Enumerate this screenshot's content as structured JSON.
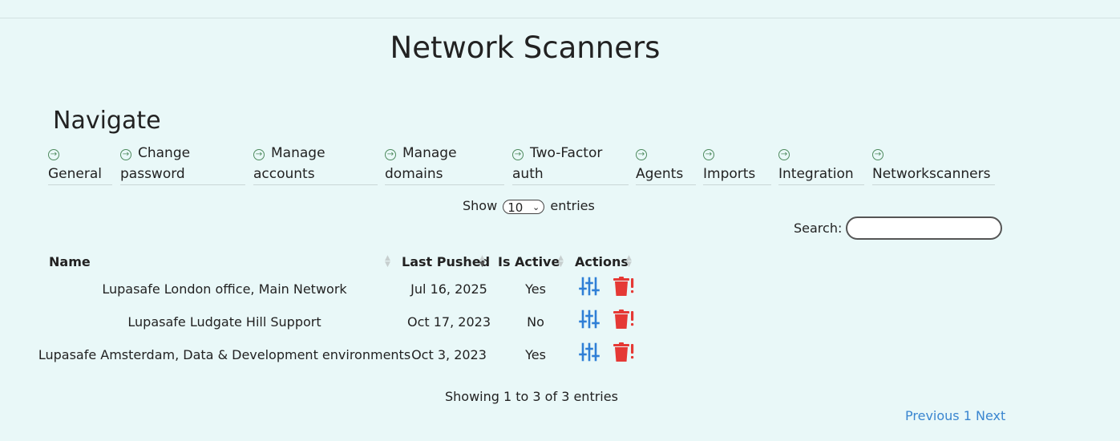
{
  "page": {
    "title": "Network Scanners"
  },
  "nav": {
    "heading": "Navigate",
    "items": [
      {
        "line1": "",
        "line2": "General"
      },
      {
        "line1": "Change",
        "line2": "password"
      },
      {
        "line1": "Manage",
        "line2": "accounts"
      },
      {
        "line1": "Manage",
        "line2": "domains"
      },
      {
        "line1": "Two-Factor",
        "line2": "auth"
      },
      {
        "line1": "",
        "line2": "Agents"
      },
      {
        "line1": "",
        "line2": "Imports"
      },
      {
        "line1": "",
        "line2": "Integration"
      },
      {
        "line1": "",
        "line2": "Networkscanners"
      }
    ]
  },
  "table_controls": {
    "show_prefix": "Show",
    "show_value": "10",
    "show_suffix": "entries",
    "search_label": "Search:",
    "search_value": ""
  },
  "table": {
    "headers": {
      "name": "Name",
      "last_pushed": "Last Pushed",
      "is_active": "Is Active",
      "actions": "Actions"
    },
    "rows": [
      {
        "name": "Lupasafe London office, Main Network",
        "last_pushed": "Jul 16, 2025",
        "is_active": "Yes"
      },
      {
        "name": "Lupasafe Ludgate Hill Support",
        "last_pushed": "Oct 17, 2023",
        "is_active": "No"
      },
      {
        "name": "Lupasafe Amsterdam, Data & Development environments",
        "last_pushed": "Oct 3, 2023",
        "is_active": "Yes"
      }
    ]
  },
  "footer": {
    "info": "Showing 1 to 3 of 3 entries",
    "previous": "Previous",
    "page": "1",
    "next": "Next"
  },
  "icons": {
    "nav_arrow": "circle-arrow-right-icon",
    "edit": "sliders-icon",
    "delete": "trash-alert-icon"
  },
  "colors": {
    "background": "#e9f8f8",
    "link": "#3a86d0",
    "edit_icon": "#2f7fd6",
    "delete_icon": "#e53935",
    "nav_arrow": "#4e8a5e"
  }
}
